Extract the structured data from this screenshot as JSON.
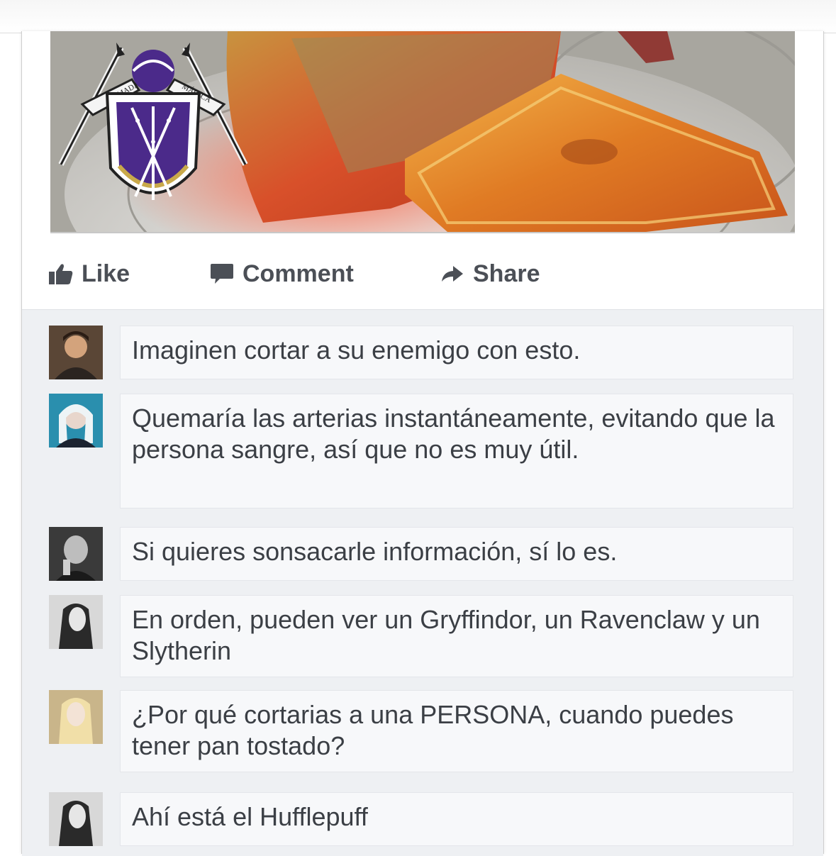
{
  "actions": {
    "like": "Like",
    "comment": "Comment",
    "share": "Share"
  },
  "comments": [
    {
      "text": "Imaginen cortar a su enemigo con esto."
    },
    {
      "text": "Quemaría las arterias instantáneamente, evitando que la persona sangre, así que no es muy útil."
    },
    {
      "text": "Si quieres sonsacarle información, sí lo es."
    },
    {
      "text": "En orden, pueden ver un Gryffindor, un Ravenclaw y un Slytherin"
    },
    {
      "text": "¿Por qué cortarias a una PERSONA, cuando puedes tener pan tostado?"
    },
    {
      "text": "Ahí está el Hufflepuff"
    }
  ],
  "crest": {
    "ribbon_left": "ARMADA",
    "ribbon_right": "MÁGICA",
    "color": "#4b2a8a"
  },
  "colors": {
    "action_text": "#4b4f56",
    "comment_bg": "#eef0f3",
    "bubble_bg": "#f7f8fa"
  }
}
